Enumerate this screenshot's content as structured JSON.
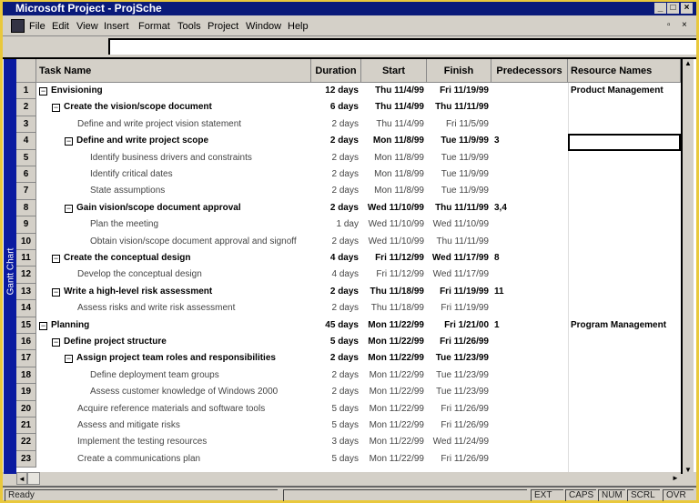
{
  "window": {
    "title": "Microsoft Project - ProjSche"
  },
  "menu": [
    "File",
    "Edit",
    "View",
    "Insert",
    "Format",
    "Tools",
    "Project",
    "Window",
    "Help"
  ],
  "view_bar_label": "Gantt Chart",
  "columns": [
    "Task Name",
    "Duration",
    "Start",
    "Finish",
    "Predecessors",
    "Resource Names"
  ],
  "rows": [
    {
      "id": "1",
      "name": "Envisioning",
      "level": 0,
      "bold": true,
      "summary": true,
      "duration": "12 days",
      "start": "Thu 11/4/99",
      "finish": "Fri 11/19/99",
      "pred": "",
      "resource": "Product Management"
    },
    {
      "id": "2",
      "name": "Create the vision/scope document",
      "level": 1,
      "bold": true,
      "summary": true,
      "duration": "6 days",
      "start": "Thu 11/4/99",
      "finish": "Thu 11/11/99",
      "pred": "",
      "resource": ""
    },
    {
      "id": "3",
      "name": "Define and write project vision statement",
      "level": 2,
      "bold": false,
      "summary": false,
      "duration": "2 days",
      "start": "Thu 11/4/99",
      "finish": "Fri 11/5/99",
      "pred": "",
      "resource": ""
    },
    {
      "id": "4",
      "name": "Define and write project scope",
      "level": 2,
      "bold": true,
      "summary": true,
      "duration": "2 days",
      "start": "Mon 11/8/99",
      "finish": "Tue 11/9/99",
      "pred": "3",
      "resource": ""
    },
    {
      "id": "5",
      "name": "Identify business drivers and constraints",
      "level": 3,
      "bold": false,
      "summary": false,
      "duration": "2 days",
      "start": "Mon 11/8/99",
      "finish": "Tue 11/9/99",
      "pred": "",
      "resource": ""
    },
    {
      "id": "6",
      "name": "Identify critical dates",
      "level": 3,
      "bold": false,
      "summary": false,
      "duration": "2 days",
      "start": "Mon 11/8/99",
      "finish": "Tue 11/9/99",
      "pred": "",
      "resource": ""
    },
    {
      "id": "7",
      "name": "State assumptions",
      "level": 3,
      "bold": false,
      "summary": false,
      "duration": "2 days",
      "start": "Mon 11/8/99",
      "finish": "Tue 11/9/99",
      "pred": "",
      "resource": ""
    },
    {
      "id": "8",
      "name": "Gain vision/scope document approval",
      "level": 2,
      "bold": true,
      "summary": true,
      "duration": "2 days",
      "start": "Wed 11/10/99",
      "finish": "Thu 11/11/99",
      "pred": "3,4",
      "resource": ""
    },
    {
      "id": "9",
      "name": "Plan the meeting",
      "level": 3,
      "bold": false,
      "summary": false,
      "duration": "1 day",
      "start": "Wed 11/10/99",
      "finish": "Wed 11/10/99",
      "pred": "",
      "resource": ""
    },
    {
      "id": "10",
      "name": "Obtain vision/scope document approval and signoff",
      "level": 3,
      "bold": false,
      "summary": false,
      "duration": "2 days",
      "start": "Wed 11/10/99",
      "finish": "Thu 11/11/99",
      "pred": "",
      "resource": ""
    },
    {
      "id": "11",
      "name": "Create the conceptual design",
      "level": 1,
      "bold": true,
      "summary": true,
      "duration": "4 days",
      "start": "Fri 11/12/99",
      "finish": "Wed 11/17/99",
      "pred": "8",
      "resource": ""
    },
    {
      "id": "12",
      "name": "Develop the conceptual design",
      "level": 2,
      "bold": false,
      "summary": false,
      "duration": "4 days",
      "start": "Fri 11/12/99",
      "finish": "Wed 11/17/99",
      "pred": "",
      "resource": ""
    },
    {
      "id": "13",
      "name": "Write a high-level risk assessment",
      "level": 1,
      "bold": true,
      "summary": true,
      "duration": "2 days",
      "start": "Thu 11/18/99",
      "finish": "Fri 11/19/99",
      "pred": "11",
      "resource": ""
    },
    {
      "id": "14",
      "name": "Assess risks and write risk assessment",
      "level": 2,
      "bold": false,
      "summary": false,
      "duration": "2 days",
      "start": "Thu 11/18/99",
      "finish": "Fri 11/19/99",
      "pred": "",
      "resource": ""
    },
    {
      "id": "15",
      "name": "Planning",
      "level": 0,
      "bold": true,
      "summary": true,
      "duration": "45 days",
      "start": "Mon 11/22/99",
      "finish": "Fri 1/21/00",
      "pred": "1",
      "resource": "Program Management"
    },
    {
      "id": "16",
      "name": "Define project structure",
      "level": 1,
      "bold": true,
      "summary": true,
      "duration": "5 days",
      "start": "Mon 11/22/99",
      "finish": "Fri 11/26/99",
      "pred": "",
      "resource": ""
    },
    {
      "id": "17",
      "name": "Assign project team roles and responsibilities",
      "level": 2,
      "bold": true,
      "summary": true,
      "duration": "2 days",
      "start": "Mon 11/22/99",
      "finish": "Tue 11/23/99",
      "pred": "",
      "resource": ""
    },
    {
      "id": "18",
      "name": "Define deployment team groups",
      "level": 3,
      "bold": false,
      "summary": false,
      "duration": "2 days",
      "start": "Mon 11/22/99",
      "finish": "Tue 11/23/99",
      "pred": "",
      "resource": ""
    },
    {
      "id": "19",
      "name": "Assess customer knowledge of Windows 2000",
      "level": 3,
      "bold": false,
      "summary": false,
      "duration": "2 days",
      "start": "Mon 11/22/99",
      "finish": "Tue 11/23/99",
      "pred": "",
      "resource": ""
    },
    {
      "id": "20",
      "name": "Acquire reference materials and software tools",
      "level": 2,
      "bold": false,
      "summary": false,
      "duration": "5 days",
      "start": "Mon 11/22/99",
      "finish": "Fri 11/26/99",
      "pred": "",
      "resource": ""
    },
    {
      "id": "21",
      "name": "Assess and mitigate risks",
      "level": 2,
      "bold": false,
      "summary": false,
      "duration": "5 days",
      "start": "Mon 11/22/99",
      "finish": "Fri 11/26/99",
      "pred": "",
      "resource": ""
    },
    {
      "id": "22",
      "name": "Implement the testing resources",
      "level": 2,
      "bold": false,
      "summary": false,
      "duration": "3 days",
      "start": "Mon 11/22/99",
      "finish": "Wed 11/24/99",
      "pred": "",
      "resource": ""
    },
    {
      "id": "23",
      "name": "Create a communications plan",
      "level": 2,
      "bold": false,
      "summary": false,
      "duration": "5 days",
      "start": "Mon 11/22/99",
      "finish": "Fri 11/26/99",
      "pred": "",
      "resource": ""
    }
  ],
  "status": {
    "text": "Ready",
    "indicators": [
      "EXT",
      "CAPS",
      "NUM",
      "SCRL",
      "OVR"
    ]
  }
}
